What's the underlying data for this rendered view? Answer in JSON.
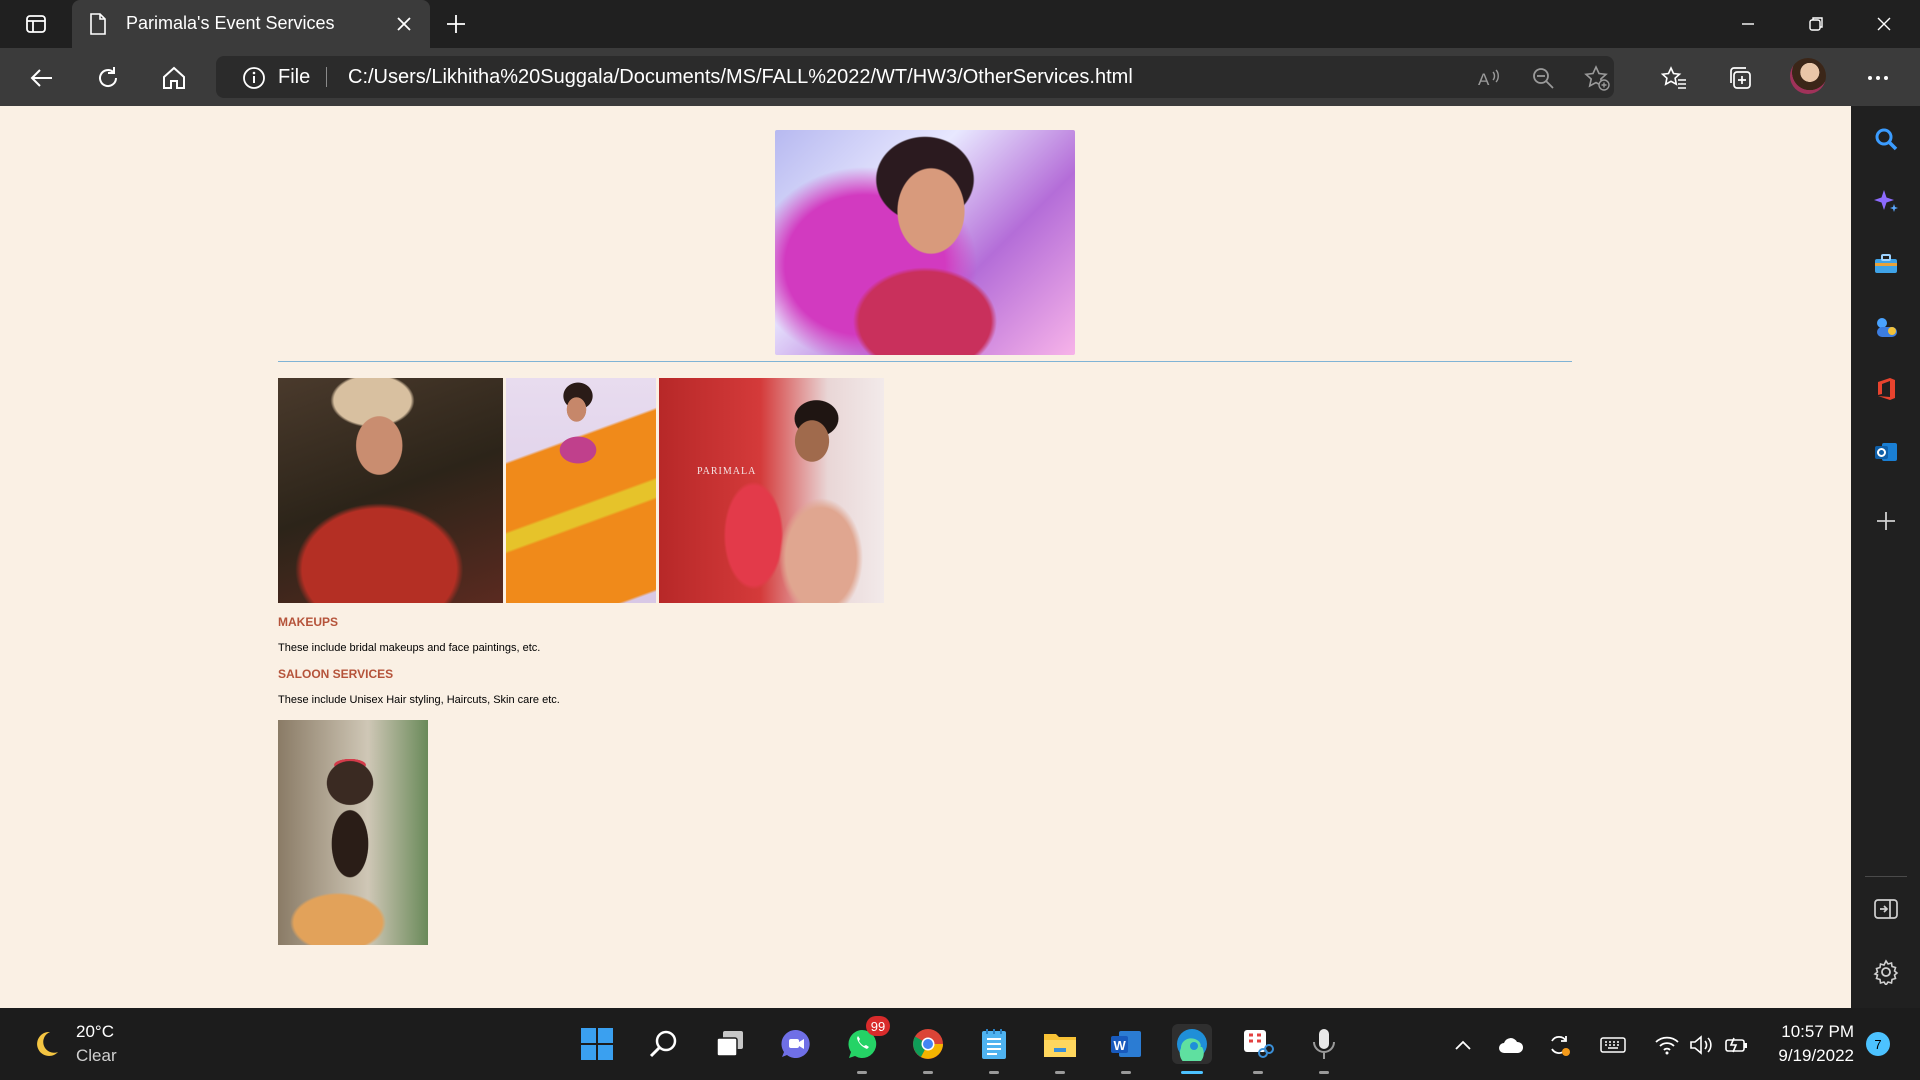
{
  "browser": {
    "tab_title": "Parimala's Event Services",
    "address_scheme": "File",
    "url": "C:/Users/Likhitha%20Suggala/Documents/MS/FALL%2022/WT/HW3/OtherServices.html"
  },
  "page": {
    "watermark": "PARIMALA",
    "sections": [
      {
        "title": "MAKEUPS",
        "text": "These include bridal makeups and face paintings, etc."
      },
      {
        "title": "SALOON SERVICES",
        "text": "These include Unisex Hair styling, Haircuts, Skin care etc."
      }
    ]
  },
  "taskbar": {
    "weather_temp": "20°C",
    "weather_cond": "Clear",
    "whatsapp_badge": "99",
    "time": "10:57 PM",
    "date": "9/19/2022",
    "notifications": "7"
  },
  "colors": {
    "page_background": "#faf0e4",
    "section_title": "#b5533a",
    "divider": "#7fb3d5",
    "accent": "#4cc2ff"
  }
}
